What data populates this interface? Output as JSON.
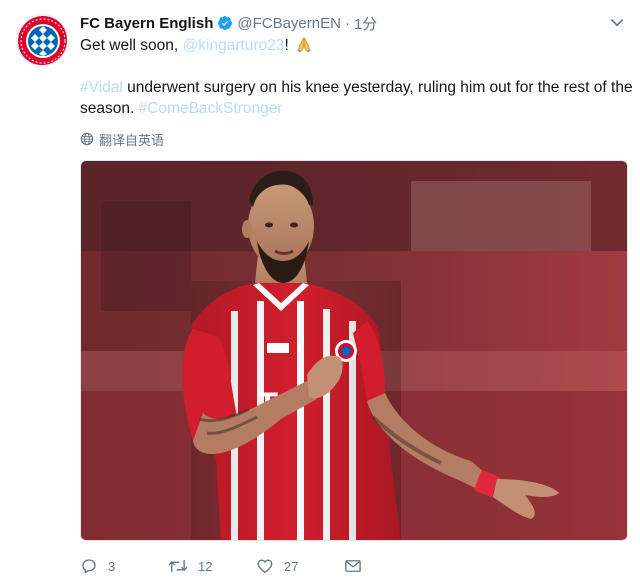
{
  "tweet": {
    "display_name": "FC Bayern English",
    "handle": "@FCBayernEN",
    "dot": "·",
    "time": "1分",
    "line1_text": "Get well soon, ",
    "line1_mention": "@kingarturo23",
    "line1_end": "!",
    "line2_hashtag": "#Vidal",
    "line2_text": " underwent surgery on his knee yesterday, ruling him out for the rest of the",
    "line3_text": "season. ",
    "line3_hashtag": "#ComeBackStronger",
    "translate_label": "翻译自英语",
    "counts": {
      "reply": "3",
      "retweet": "12",
      "like": "27"
    }
  },
  "colors": {
    "link": "#b6dcf4",
    "verified": "#1da1f2",
    "meta": "#657786",
    "bayern_red": "#dc052d",
    "bayern_blue": "#0066b2"
  },
  "icons": {
    "avatar": "fc-bayern-logo",
    "verified": "verified-badge-icon",
    "caret": "chevron-down-icon",
    "translate": "globe-icon",
    "emoji": "folded-hands-emoji",
    "reply": "reply-icon",
    "retweet": "retweet-icon",
    "like": "heart-icon",
    "dm": "envelope-icon"
  }
}
